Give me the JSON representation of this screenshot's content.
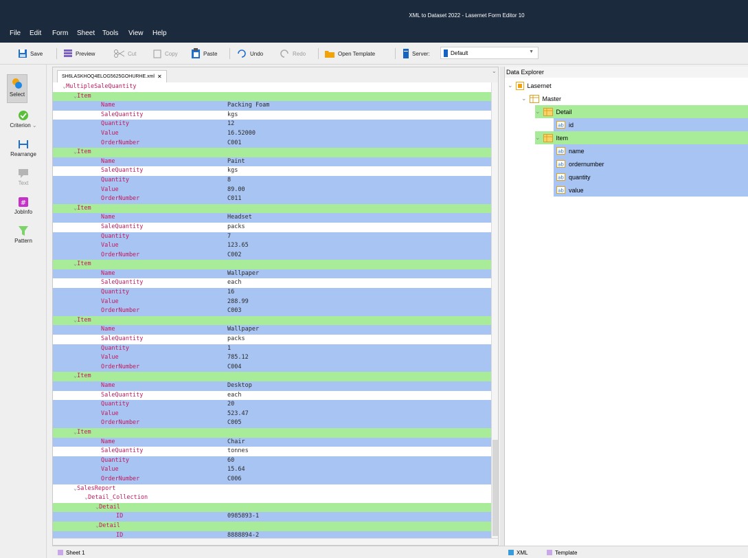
{
  "window": {
    "title": "XML to Dataset 2022 - Lasernet Form Editor 10"
  },
  "menu": [
    {
      "label": "File",
      "accel": "F",
      "rest": "ile"
    },
    {
      "label": "Edit",
      "accel": "E",
      "rest": "dit"
    },
    {
      "label": "Form",
      "accel": "F",
      "rest": "orm"
    },
    {
      "label": "Sheet",
      "accel": "S",
      "rest": "heet"
    },
    {
      "label": "Tools",
      "accel": "T",
      "rest": "ools"
    },
    {
      "label": "View",
      "accel": "V",
      "rest": "iew"
    },
    {
      "label": "Help",
      "accel": "H",
      "rest": "elp"
    }
  ],
  "toolbar": {
    "save": "Save",
    "preview": "Preview",
    "cut": "Cut",
    "copy": "Copy",
    "paste": "Paste",
    "undo": "Undo",
    "redo": "Redo",
    "open_template": "Open Template",
    "server_label": "Server:",
    "server_value": "Default"
  },
  "left_tools": {
    "select": "Select",
    "criterion": "Criterion",
    "rearrange": "Rearrange",
    "text": "Text",
    "jobinfo": "JobInfo",
    "pattern": "Pattern"
  },
  "editor": {
    "tab": "SH6LASKHOQ4ELOG5625GOHURHE.xml",
    "root": "MultipleSaleQuantity",
    "item_label": "Item",
    "field_names": [
      "Name",
      "SaleQuantity",
      "Quantity",
      "Value",
      "OrderNumber"
    ],
    "items": [
      {
        "Name": "Packing Foam",
        "SaleQuantity": "kgs",
        "Quantity": "12",
        "Value": "16.52000",
        "OrderNumber": "C001"
      },
      {
        "Name": "Paint",
        "SaleQuantity": "kgs",
        "Quantity": "8",
        "Value": "89.00",
        "OrderNumber": "C011"
      },
      {
        "Name": "Headset",
        "SaleQuantity": "packs",
        "Quantity": "7",
        "Value": "123.65",
        "OrderNumber": "C002"
      },
      {
        "Name": "Wallpaper",
        "SaleQuantity": "each",
        "Quantity": "16",
        "Value": "288.99",
        "OrderNumber": "C003"
      },
      {
        "Name": "Wallpaper",
        "SaleQuantity": "packs",
        "Quantity": "1",
        "Value": "785.12",
        "OrderNumber": "C004"
      },
      {
        "Name": "Desktop",
        "SaleQuantity": "each",
        "Quantity": "20",
        "Value": "523.47",
        "OrderNumber": "C005"
      },
      {
        "Name": "Chair",
        "SaleQuantity": "tonnes",
        "Quantity": "60",
        "Value": "15.64",
        "OrderNumber": "C006"
      }
    ],
    "sales_report": "SalesReport",
    "detail_collection": "Detail_Collection",
    "detail_label": "Detail",
    "id_label": "ID",
    "details": [
      "0985893-1",
      "8888894-2"
    ]
  },
  "data_explorer": {
    "title": "Data Explorer",
    "nodes": {
      "lasernet": "Lasernet",
      "master": "Master",
      "detail": "Detail",
      "id": "id",
      "item": "Item",
      "name": "name",
      "ordernumber": "ordernumber",
      "quantity": "quantity",
      "value": "value"
    }
  },
  "bottom": {
    "sheet_tab": "Sheet 1",
    "xml_tab": "XML",
    "template_tab": "Template"
  },
  "colors": {
    "row_blue": "#a8c4f2",
    "row_green": "#a8ec9a",
    "key_text": "#c2185b",
    "title_bar": "#1b2a3c"
  }
}
